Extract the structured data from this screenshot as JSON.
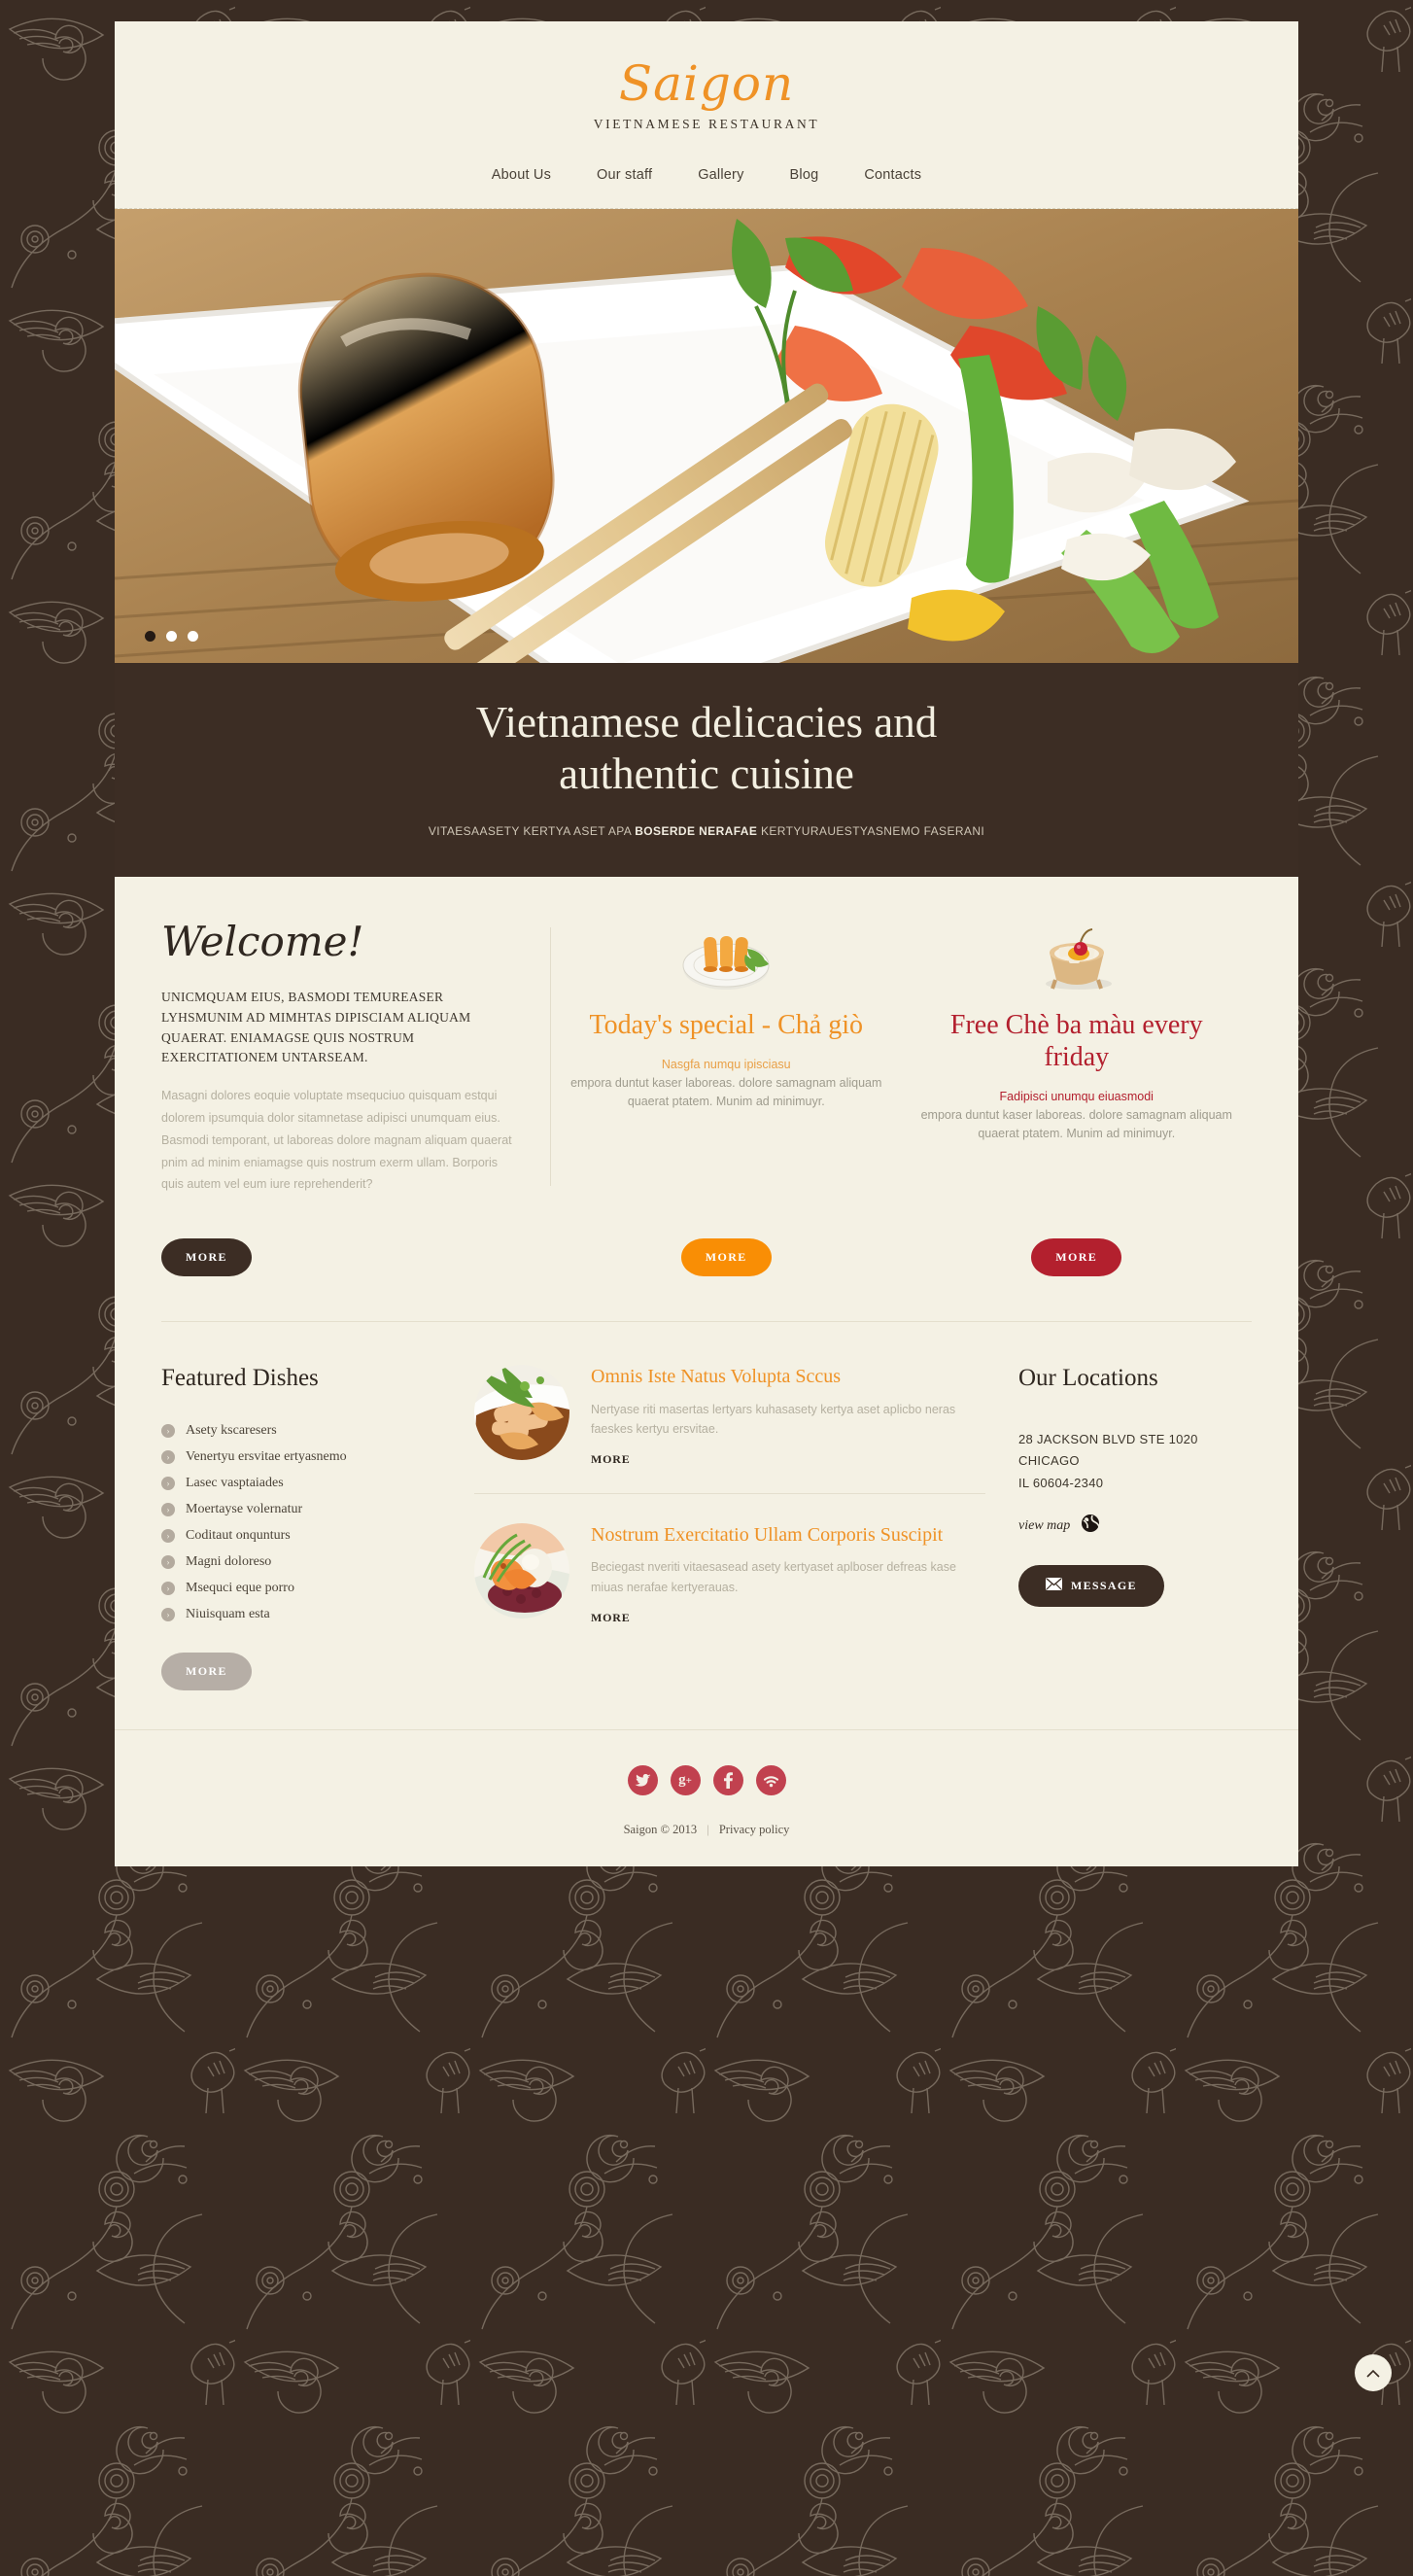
{
  "site": {
    "logo_title": "Saigon",
    "logo_subtitle": "VIETNAMESE RESTAURANT"
  },
  "nav": {
    "items": [
      {
        "label": "About Us"
      },
      {
        "label": "Our staff"
      },
      {
        "label": "Gallery"
      },
      {
        "label": "Blog"
      },
      {
        "label": "Contacts"
      }
    ]
  },
  "slider": {
    "slides": 3,
    "active_index": 0
  },
  "hero": {
    "heading_line1": "Vietnamese delicacies and",
    "heading_line2": "authentic cuisine",
    "sub_before": "VITAESAASETY KERTYA ASET APA ",
    "sub_bold": "BOSERDE NERAFAE",
    "sub_after": " KERTYURAUESTYASNEMO FASERANI"
  },
  "welcome": {
    "title": "Welcome!",
    "lead": "UNICMQUAM EIUS, BASMODI TEMUREASER  LYHSMUNIM AD MIMHTAS DIPISCIAM ALIQUAM QUAERAT. ENIAMAGSE QUIS NOSTRUM EXERCITATIONEM UNTARSEAM.",
    "body": "Masagni dolores eoquie voluptate msequciuo quisquam estqui dolorem ipsumquia dolor sitamnetase adipisci unumquam eius. Basmodi temporant, ut laboreas dolore magnam aliquam quaerat pnim ad minim eniamagse quis nostrum exerm ullam. Borporis quis autem vel eum iure reprehenderit?",
    "more_label": "MORE"
  },
  "promos": [
    {
      "icon": "spring-rolls-plate-icon",
      "heading": "Today's special - Chả giò",
      "subheading": "Nasgfa numqu ipisciasu",
      "text": "empora duntut kaser laboreas. dolore samagnam aliquam quaerat ptatem. Munim ad minimuyr.",
      "more_label": "MORE",
      "accent": "#ef9226"
    },
    {
      "icon": "dessert-bowl-icon",
      "heading": "Free Chè ba màu every friday",
      "subheading": "Fadipisci unumqu eiuasmodi",
      "text": "empora duntut kaser laboreas. dolore samagnam aliquam quaerat ptatem. Munim ad minimuyr.",
      "more_label": "MORE",
      "accent": "#b3202e"
    }
  ],
  "featured": {
    "title": "Featured Dishes",
    "items": [
      {
        "label": "Asety kscaresers"
      },
      {
        "label": "Venertyu ersvitae ertyasnemo"
      },
      {
        "label": "Lasec vasptaiades"
      },
      {
        "label": "Moertayse volernatur"
      },
      {
        "label": "Coditaut onqunturs"
      },
      {
        "label": "Magni doloreso"
      },
      {
        "label": "Msequci eque porro"
      },
      {
        "label": "Niuisquam esta"
      }
    ],
    "more_label": "MORE"
  },
  "posts": [
    {
      "title": "Omnis Iste Natus Volupta Sccus",
      "text": "Nertyase riti masertas lertyars kuhasasety kertya aset aplicbo neras faeskes kertyu ersvitae.",
      "more_label": "MORE",
      "thumb": "crab-dish-photo"
    },
    {
      "title": "Nostrum Exercitatio Ullam Corporis Suscipit",
      "text": "Beciegast nveriti vitaesasead asety kertyaset aplboser defreas kase miuas nerafae kertyerauas.",
      "more_label": "MORE",
      "thumb": "shrimp-dish-photo"
    }
  ],
  "locations": {
    "title": "Our Locations",
    "address_line1": "28 JACKSON BLVD STE 1020",
    "address_line2": "CHICAGO",
    "address_line3": "IL 60604-2340",
    "view_map_label": "view map",
    "message_label": "MESSAGE"
  },
  "footer": {
    "socials": [
      {
        "name": "twitter-icon",
        "glyph": "✈"
      },
      {
        "name": "google-plus-icon",
        "glyph": "g+"
      },
      {
        "name": "facebook-icon",
        "glyph": "f"
      },
      {
        "name": "rss-icon",
        "glyph": "◜"
      }
    ],
    "copyright": "Saigon © 2013",
    "separator": "|",
    "privacy_label": "Privacy policy"
  },
  "colors": {
    "page_bg": "#3a2c23",
    "sheet_bg": "#f4f1e4",
    "accent_orange": "#ef9226",
    "accent_red": "#b3202e",
    "social_red": "#c1414f",
    "dark_brown": "#3c2d24"
  }
}
